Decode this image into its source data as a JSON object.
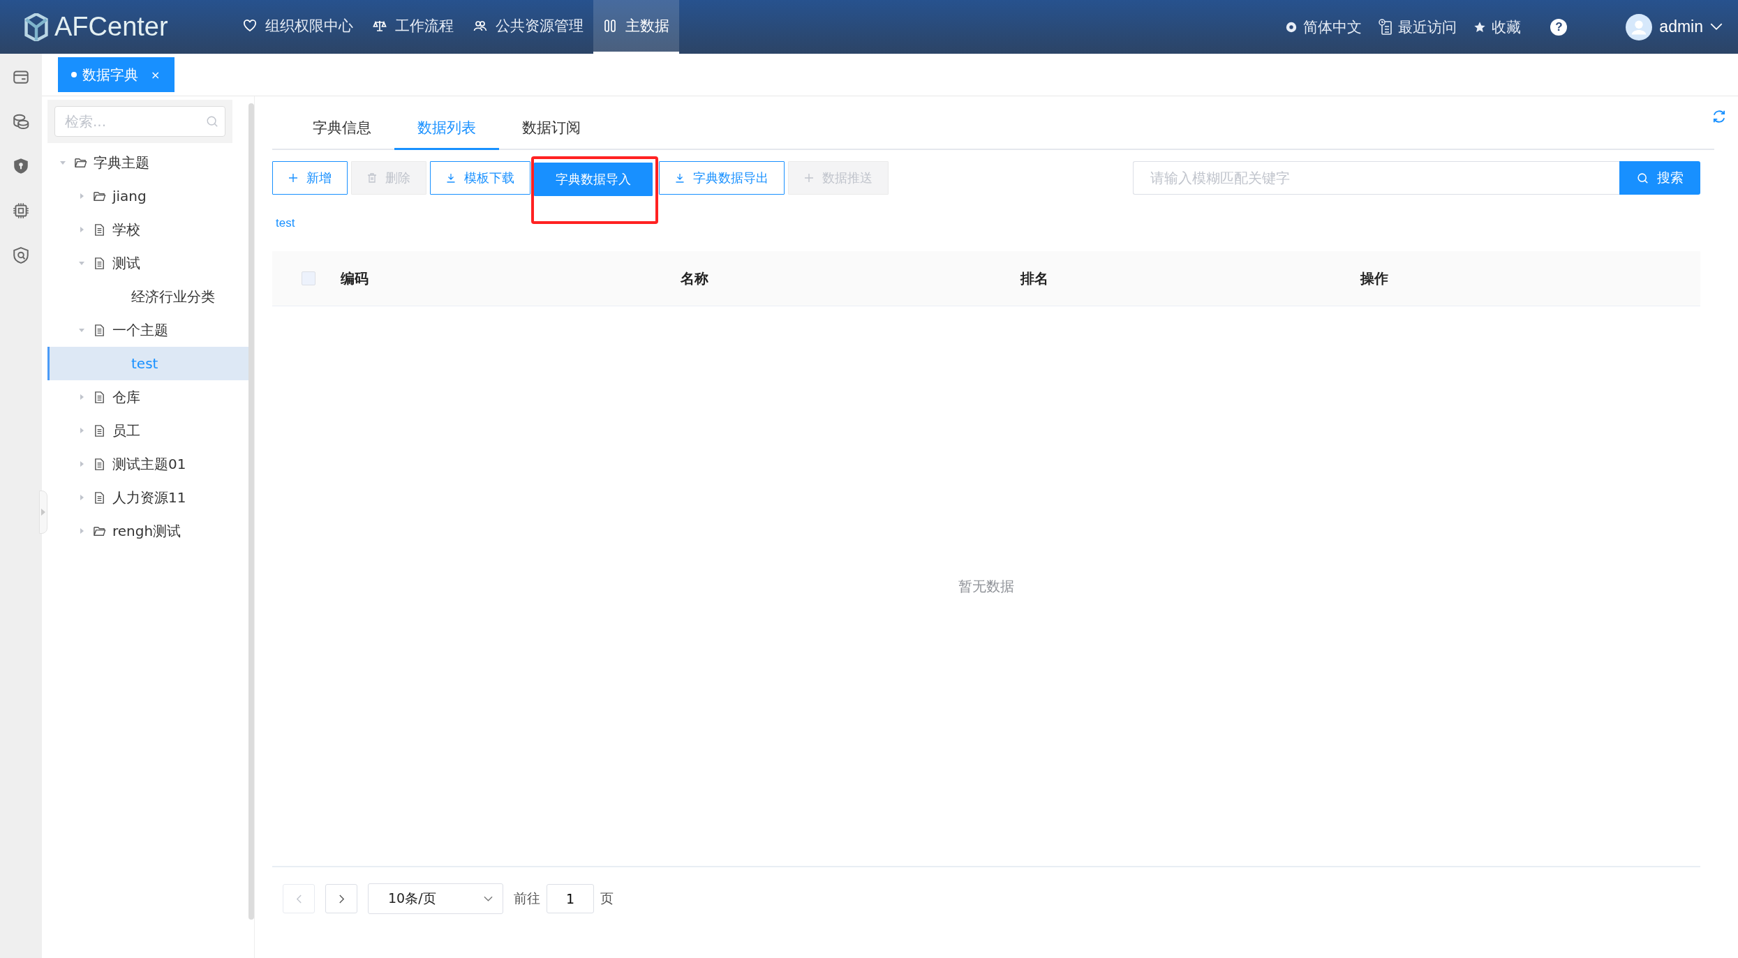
{
  "header": {
    "logo": "AFCenter",
    "nav": [
      {
        "label": "组织权限中心",
        "selected": false
      },
      {
        "label": "工作流程",
        "selected": false
      },
      {
        "label": "公共资源管理",
        "selected": false
      },
      {
        "label": "主数据",
        "selected": true
      }
    ],
    "tools": [
      "简体中文",
      "最近访问",
      "收藏"
    ],
    "help": "?",
    "user": "admin"
  },
  "open_tabs": [
    {
      "label": "数据字典",
      "close": "×",
      "selected": true
    }
  ],
  "tree": {
    "search_placeholder": "检索...",
    "nodes": [
      {
        "label": "字典主题",
        "kind": "folder",
        "expanded": true,
        "selected": false,
        "children": [
          {
            "label": "jiang",
            "kind": "folder",
            "expanded": false,
            "selected": false
          },
          {
            "label": "学校",
            "kind": "document",
            "expanded": false,
            "selected": false
          },
          {
            "label": "测试",
            "kind": "document",
            "expanded": true,
            "selected": false,
            "children": [
              {
                "label": "经济行业分类",
                "kind": "leaf",
                "selected": false
              }
            ]
          },
          {
            "label": "一个主题",
            "kind": "document",
            "expanded": true,
            "selected": false,
            "children": [
              {
                "label": "test",
                "kind": "leaf",
                "selected": true
              }
            ]
          },
          {
            "label": "仓库",
            "kind": "document",
            "expanded": false,
            "selected": false
          },
          {
            "label": "员工",
            "kind": "document",
            "expanded": false,
            "selected": false
          },
          {
            "label": "测试主题01",
            "kind": "document",
            "expanded": false,
            "selected": false
          },
          {
            "label": "人力资源11",
            "kind": "document",
            "expanded": false,
            "selected": false
          },
          {
            "label": "rengh测试",
            "kind": "folder",
            "expanded": false,
            "selected": false
          }
        ]
      }
    ]
  },
  "content": {
    "tabs": [
      {
        "label": "字典信息",
        "selected": false
      },
      {
        "label": "数据列表",
        "selected": true
      },
      {
        "label": "数据订阅",
        "selected": false
      }
    ],
    "toolbar": [
      {
        "label": "新增",
        "kind": "plain",
        "disabled": false,
        "highlighted": false
      },
      {
        "label": "删除",
        "kind": "plain",
        "disabled": true,
        "highlighted": false
      },
      {
        "label": "模板下载",
        "kind": "plain",
        "disabled": false,
        "highlighted": false
      },
      {
        "label": "字典数据导入",
        "kind": "primary",
        "disabled": false,
        "highlighted": true
      },
      {
        "label": "字典数据导出",
        "kind": "plain",
        "disabled": false,
        "highlighted": false
      },
      {
        "label": "数据推送",
        "kind": "plain",
        "disabled": true,
        "highlighted": false
      }
    ],
    "search": {
      "placeholder": "请输入模糊匹配关键字",
      "button": "搜索"
    },
    "breadcrumb": "test",
    "table": {
      "select_all": {
        "checked": false
      },
      "columns": [
        "编码",
        "名称",
        "排名",
        "操作"
      ],
      "empty_text": "暂无数据"
    },
    "pagination": {
      "page_size": "10条/页",
      "goto_label": "前往",
      "page": "1",
      "page_suffix": "页"
    }
  }
}
